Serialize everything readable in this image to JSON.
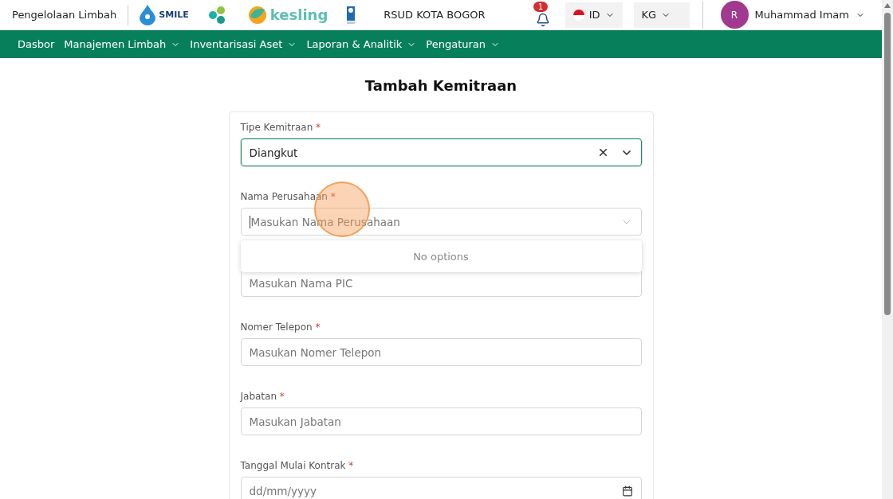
{
  "header": {
    "app_title": "Pengelolaan Limbah",
    "logos": [
      {
        "kind": "smile",
        "text": "SMILE"
      },
      {
        "kind": "kemenkes"
      },
      {
        "kind": "kesling",
        "text": "kesling"
      },
      {
        "kind": "undp"
      }
    ],
    "hospital": "RSUD KOTA BOGOR",
    "notifications": {
      "count": "1"
    },
    "language": {
      "label": "ID"
    },
    "unit": {
      "label": "KG"
    },
    "user": {
      "initial": "R",
      "name": "Muhammad Imam"
    }
  },
  "nav": [
    {
      "label": "Dasbor",
      "dropdown": false
    },
    {
      "label": "Manajemen Limbah",
      "dropdown": true
    },
    {
      "label": "Inventarisasi Aset",
      "dropdown": true
    },
    {
      "label": "Laporan & Analitik",
      "dropdown": true
    },
    {
      "label": "Pengaturan",
      "dropdown": true
    }
  ],
  "page_title": "Tambah Kemitraan",
  "form": {
    "fields": [
      {
        "kind": "select",
        "label": "Tipe Kemitraan",
        "mark": "*",
        "value": "Diangkut",
        "focused": true,
        "clearable": true
      },
      {
        "kind": "select",
        "label": "Nama Perusahaan",
        "mark": "*",
        "placeholder": "Masukan Nama Perusahaan",
        "focused": false,
        "clearable": false,
        "menu": {
          "message": "No options"
        }
      },
      {
        "kind": "text",
        "placeholder": "Masukan Nama PIC"
      },
      {
        "kind": "text",
        "label": "Nomer Telepon",
        "mark": "*",
        "placeholder": "Masukan Nomer Telepon"
      },
      {
        "kind": "text",
        "label": "Jabatan",
        "mark": "*",
        "placeholder": "Masukan Jabatan"
      },
      {
        "kind": "date",
        "label": "Tanggal Mulai Kontrak",
        "mark": "*",
        "placeholder": "dd/mm/yyyy"
      }
    ]
  }
}
